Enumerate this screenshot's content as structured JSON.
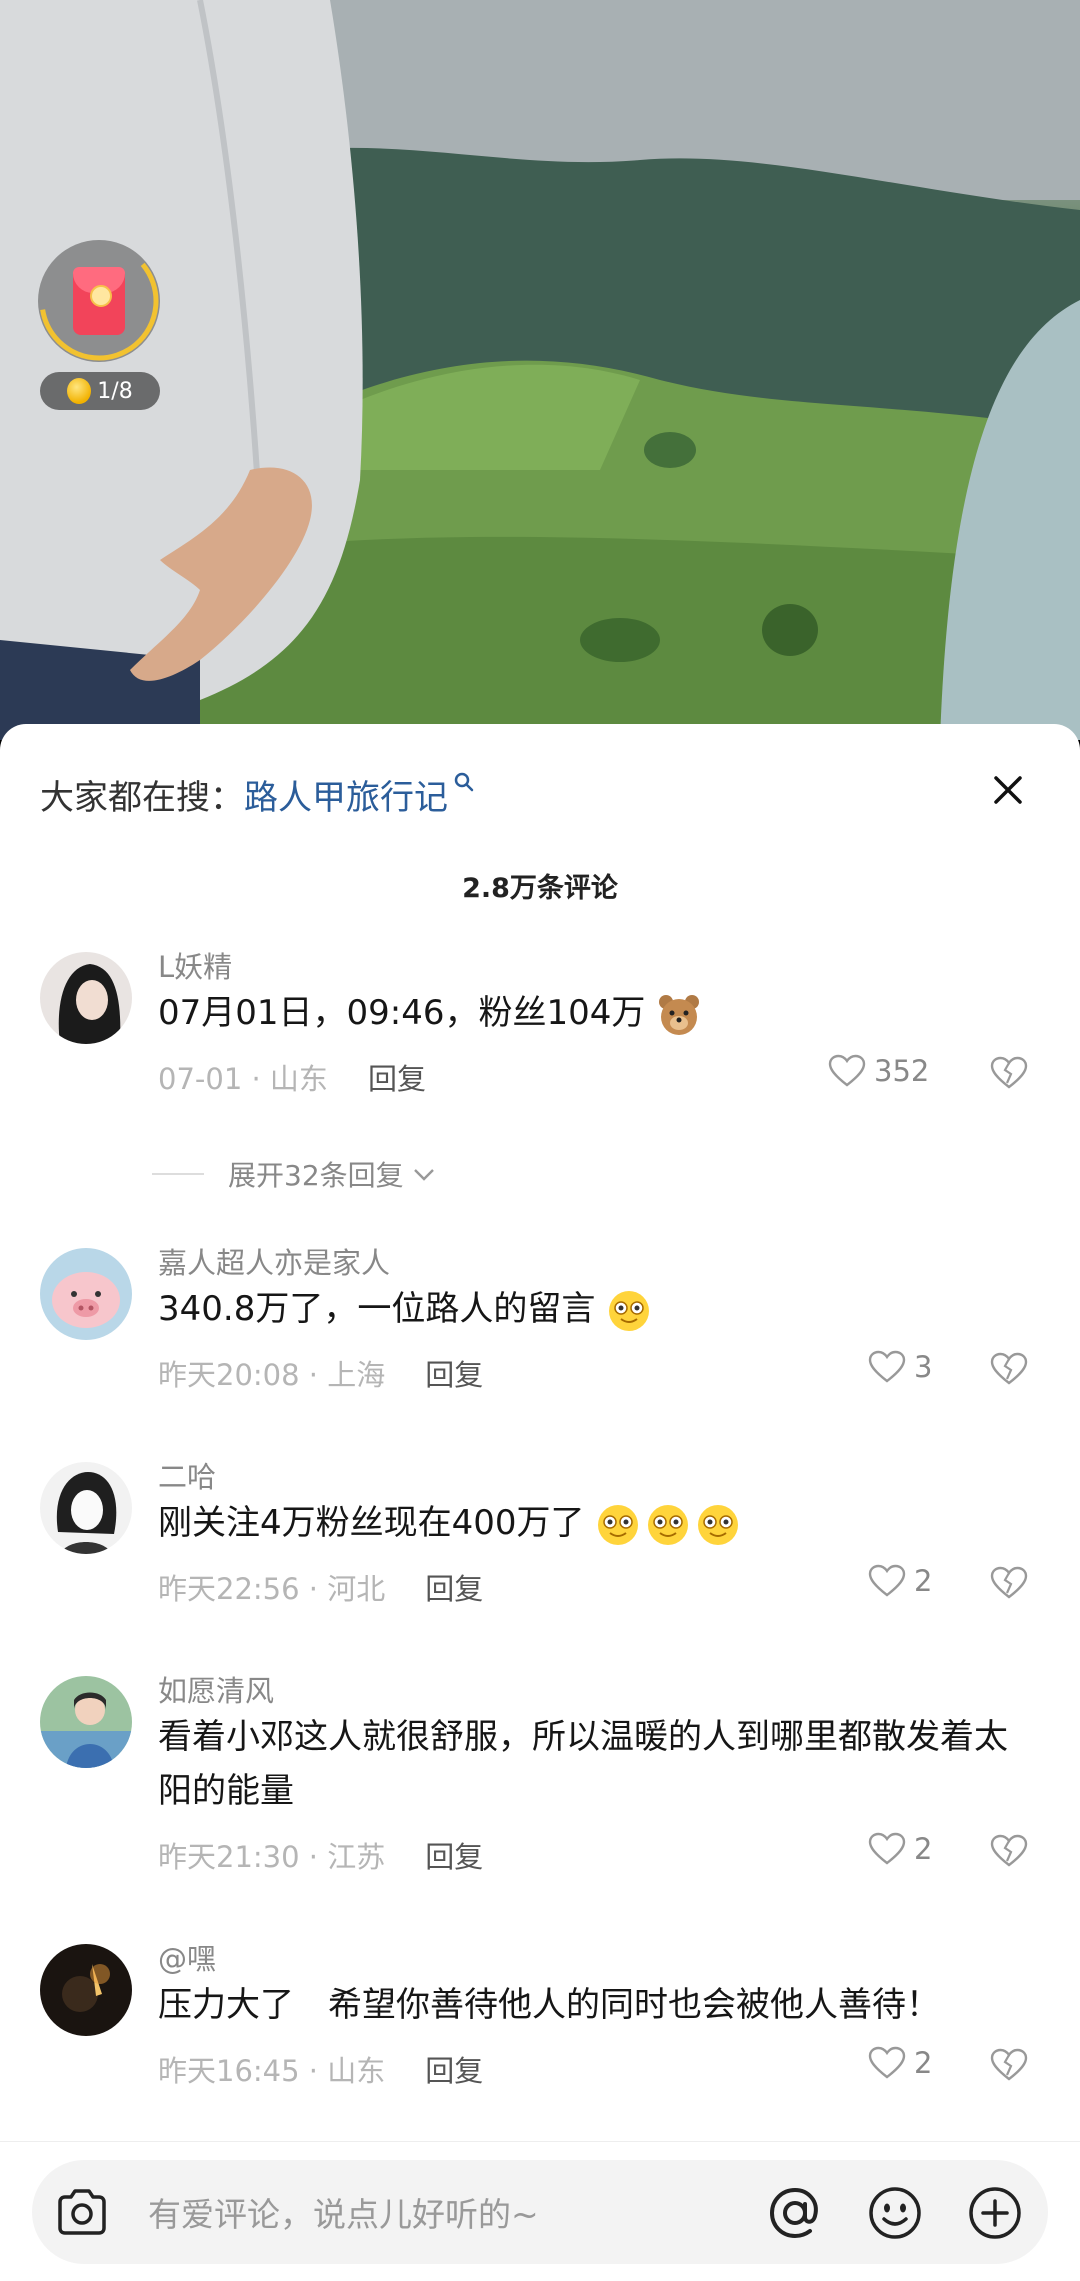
{
  "redpacket": {
    "progress": "1/8"
  },
  "search": {
    "prefix": "大家都在搜：",
    "term": "路人甲旅行记"
  },
  "comment_count": "2.8万条评论",
  "comments": [
    {
      "user": "L妖精",
      "text": "07月01日，09:46，粉丝104万",
      "emoji": "bear",
      "time_loc": "07-01 · 山东",
      "reply": "回复",
      "likes": "352"
    },
    {
      "user": "嘉人超人亦是家人",
      "text": "340.8万了，一位路人的留言",
      "emoji": "smile",
      "time_loc": "昨天20:08 · 上海",
      "reply": "回复",
      "likes": "3"
    },
    {
      "user": "二哈",
      "text": "刚关注4万粉丝现在400万了",
      "emoji": "smile3",
      "time_loc": "昨天22:56 · 河北",
      "reply": "回复",
      "likes": "2"
    },
    {
      "user": "如愿清风",
      "text": "看着小邓这人就很舒服，所以温暖的人到哪里都散发着太阳的能量",
      "time_loc": "昨天21:30 · 江苏",
      "reply": "回复",
      "likes": "2"
    },
    {
      "user": "@嘿",
      "text": "压力大了　希望你善待他人的同时也会被他人善待！",
      "time_loc": "昨天16:45 · 山东",
      "reply": "回复",
      "likes": "2"
    }
  ],
  "expand_replies": "展开32条回复",
  "input": {
    "placeholder": "有爱评论，说点儿好听的~"
  }
}
